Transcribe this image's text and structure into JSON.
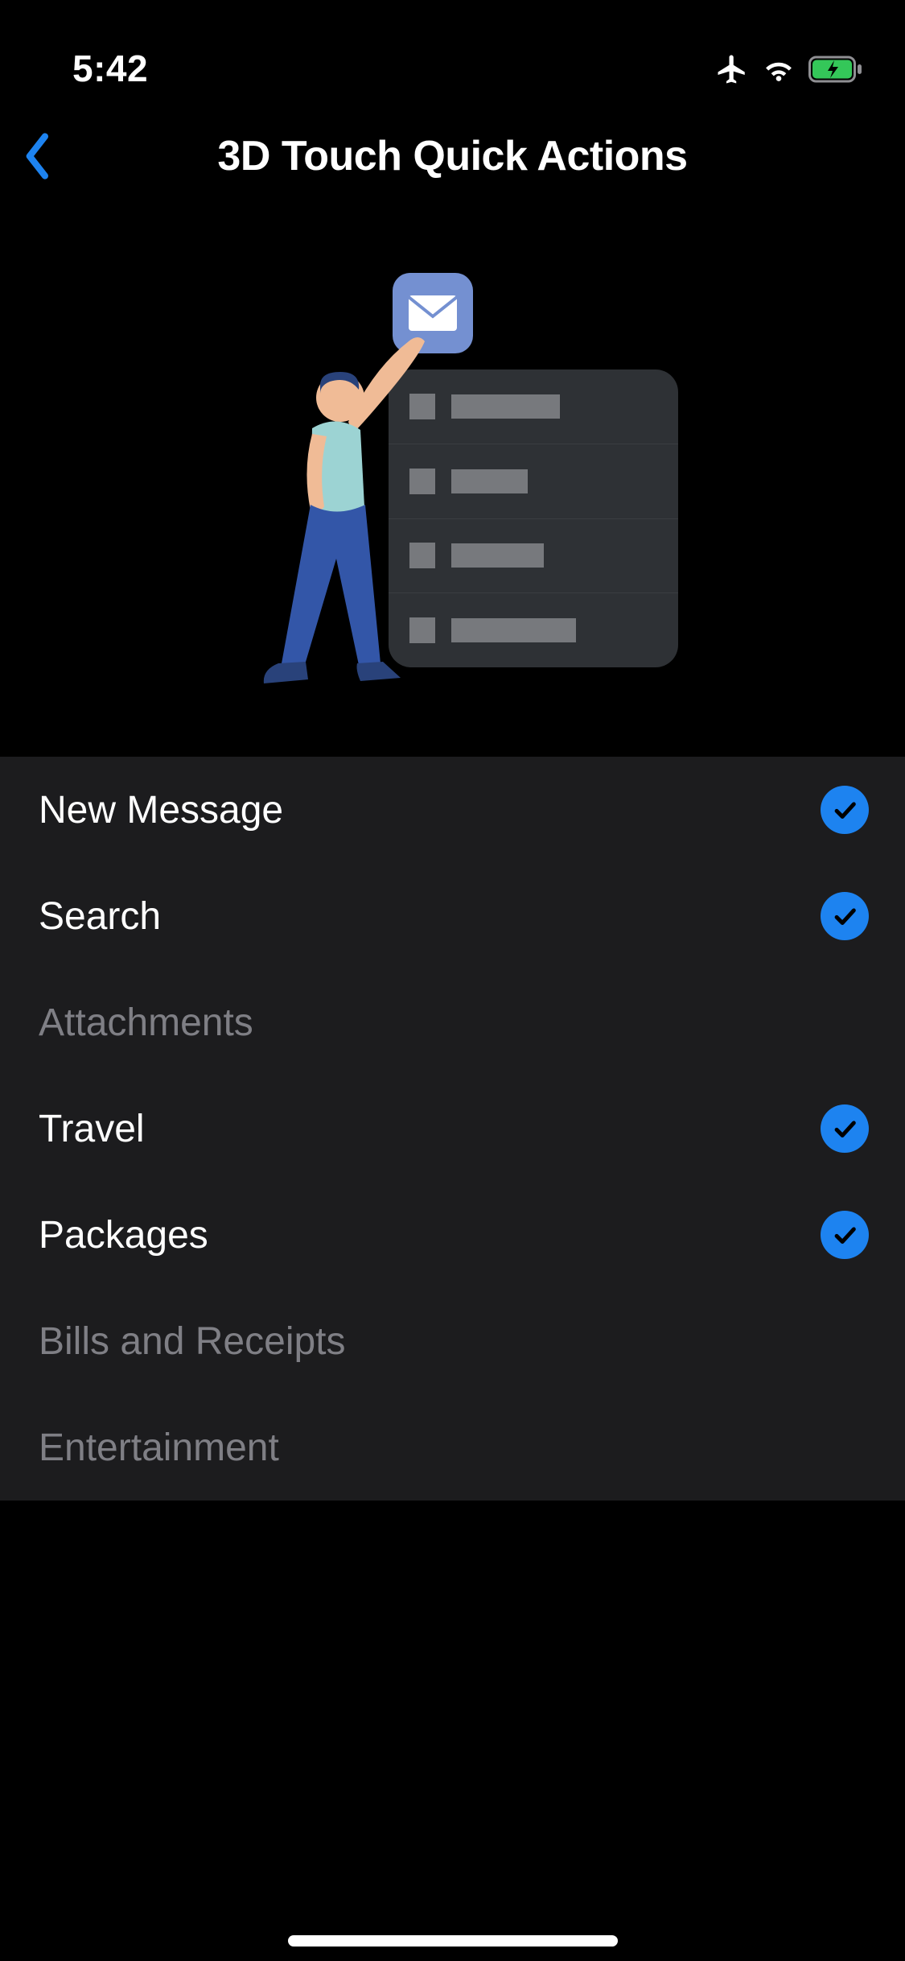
{
  "status": {
    "time": "5:42",
    "airplane_icon": "airplane",
    "wifi_icon": "wifi",
    "battery_icon": "battery-charging"
  },
  "nav": {
    "title": "3D Touch Quick Actions",
    "back_icon": "chevron-left"
  },
  "illustration": {
    "app_icon": "mail-icon",
    "menu_rows": 4
  },
  "options": [
    {
      "label": "New Message",
      "selected": true
    },
    {
      "label": "Search",
      "selected": true
    },
    {
      "label": "Attachments",
      "selected": false
    },
    {
      "label": "Travel",
      "selected": true
    },
    {
      "label": "Packages",
      "selected": true
    },
    {
      "label": "Bills and Receipts",
      "selected": false
    },
    {
      "label": "Entertainment",
      "selected": false
    }
  ],
  "colors": {
    "accent_blue": "#1d83f0",
    "bg_panel": "#1c1c1e",
    "bg_black": "#000000",
    "text_disabled": "#7f7f85"
  }
}
